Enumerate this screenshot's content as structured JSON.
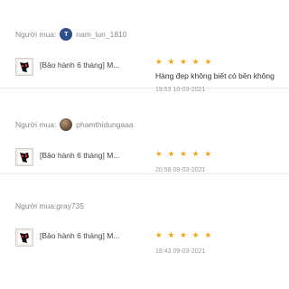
{
  "reviews": [
    {
      "buyer_label": "Người mua:",
      "avatar": "T",
      "username": "nam_lun_1810",
      "product_name": "[Bảo hành 6 tháng] M...",
      "stars": 5,
      "comment": "Hàng đẹp không biết có bền không",
      "time": "19:53 10-03-2021"
    },
    {
      "buyer_label": "Người mua:",
      "avatar": "",
      "username": "phamthidungaaa",
      "product_name": "[Bảo hành 6 tháng] M...",
      "stars": 5,
      "comment": "",
      "time": "20:58 09-03-2021"
    },
    {
      "buyer_label": "Người mua:",
      "avatar": "",
      "username": "gray735",
      "product_name": "[Bảo hành 6 tháng] M...",
      "stars": 5,
      "comment": "",
      "time": "18:43 09-03-2021"
    }
  ],
  "star_glyph": "★",
  "colors": {
    "star": "#f2a20d",
    "muted": "#8a8a8a",
    "divider": "#ececec"
  }
}
